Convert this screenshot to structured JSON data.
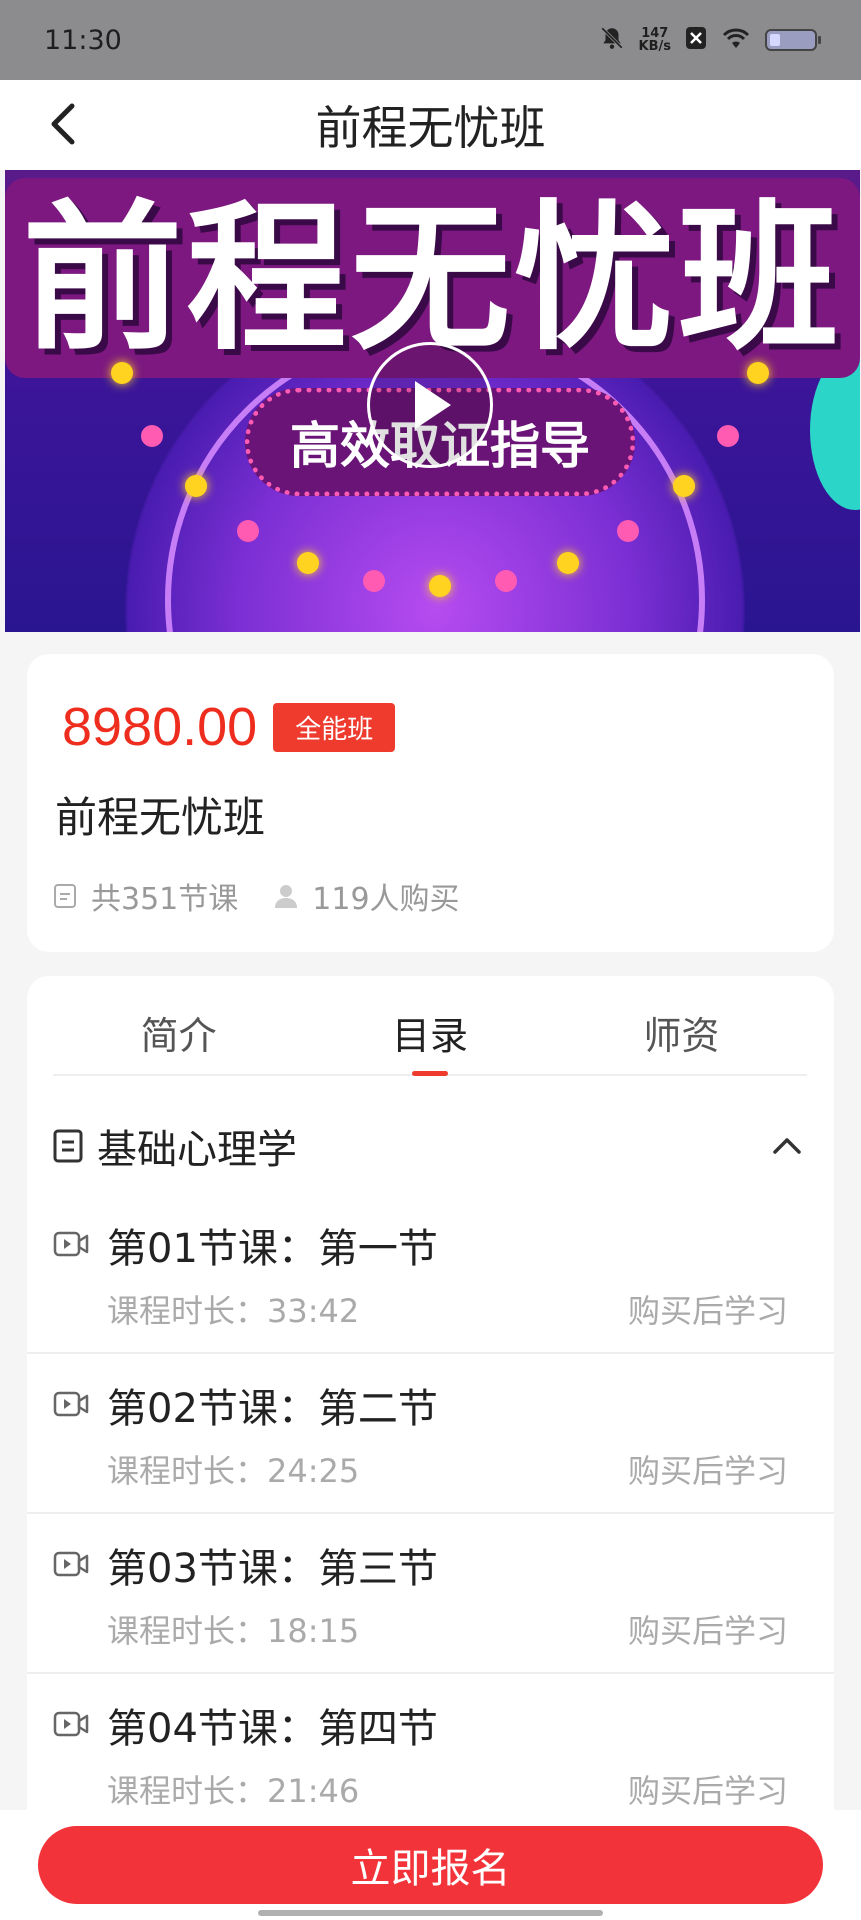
{
  "status_bar": {
    "time": "11:30",
    "speed_value": "147",
    "speed_unit": "KB/s"
  },
  "header": {
    "title": "前程无忧班"
  },
  "hero": {
    "headline": "前程无忧班",
    "subline": "高效取证指导"
  },
  "course": {
    "price": "8980.00",
    "badge": "全能班",
    "name": "前程无忧班",
    "lessons_count": "共351节课",
    "buyers": "119人购买"
  },
  "tabs": [
    {
      "label": "简介",
      "active": false
    },
    {
      "label": "目录",
      "active": true
    },
    {
      "label": "师资",
      "active": false
    }
  ],
  "section": {
    "title": "基础心理学",
    "expanded": true
  },
  "lessons": [
    {
      "title": "第01节课：第一节",
      "duration": "课程时长：33:42",
      "status": "购买后学习"
    },
    {
      "title": "第02节课：第二节",
      "duration": "课程时长：24:25",
      "status": "购买后学习"
    },
    {
      "title": "第03节课：第三节",
      "duration": "课程时长：18:15",
      "status": "购买后学习"
    },
    {
      "title": "第04节课：第四节",
      "duration": "课程时长：21:46",
      "status": "购买后学习"
    }
  ],
  "cta": {
    "label": "立即报名"
  },
  "colors": {
    "accent": "#ee3b2e",
    "button": "#f2333a",
    "price": "#ef2d1e"
  }
}
